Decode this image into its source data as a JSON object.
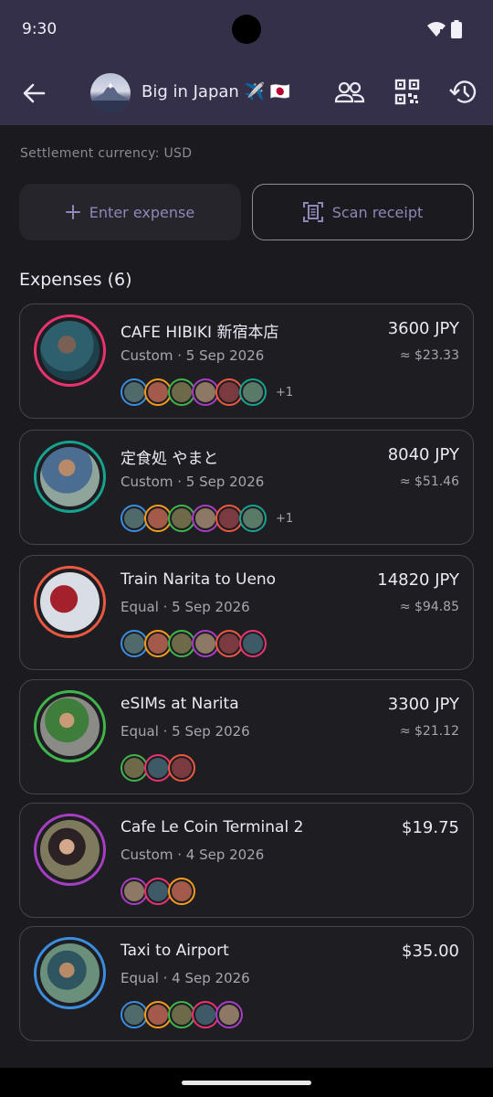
{
  "status_bar": {
    "time": "9:30",
    "icons": [
      "wifi-icon",
      "battery-icon"
    ]
  },
  "app_bar": {
    "title": "Big in Japan ✈️ 🇯🇵",
    "actions": [
      "members-icon",
      "qr-code-icon",
      "history-icon"
    ]
  },
  "settlement_label": "Settlement currency: USD",
  "actions": {
    "enter_expense": "Enter expense",
    "scan_receipt": "Scan receipt"
  },
  "expenses_header": "Expenses (6)",
  "colors": {
    "pink": "#e8336f",
    "teal": "#16a38f",
    "red": "#ec5840",
    "green": "#3fb54a",
    "purple": "#a63dc2",
    "blue": "#3b8de0",
    "orange": "#f39b1f"
  },
  "expenses": [
    {
      "title": "CAFE HIBIKI 新宿本店",
      "meta": "Custom · 5 Sep 2026",
      "amount": "3600 JPY",
      "converted": "≈ $23.33",
      "more": "+1"
    },
    {
      "title": "定食処 やまと",
      "meta": "Custom · 5 Sep 2026",
      "amount": "8040 JPY",
      "converted": "≈ $51.46",
      "more": "+1"
    },
    {
      "title": "Train Narita to Ueno",
      "meta": "Equal · 5 Sep 2026",
      "amount": "14820 JPY",
      "converted": "≈ $94.85",
      "more": ""
    },
    {
      "title": "eSIMs at Narita",
      "meta": "Equal · 5 Sep 2026",
      "amount": "3300 JPY",
      "converted": "≈ $21.12",
      "more": ""
    },
    {
      "title": "Cafe Le Coin Terminal 2",
      "meta": "Custom · 4 Sep 2026",
      "amount": "$19.75",
      "converted": "",
      "more": ""
    },
    {
      "title": "Taxi to Airport",
      "meta": "Equal · 4 Sep 2026",
      "amount": "$35.00",
      "converted": "",
      "more": ""
    }
  ]
}
